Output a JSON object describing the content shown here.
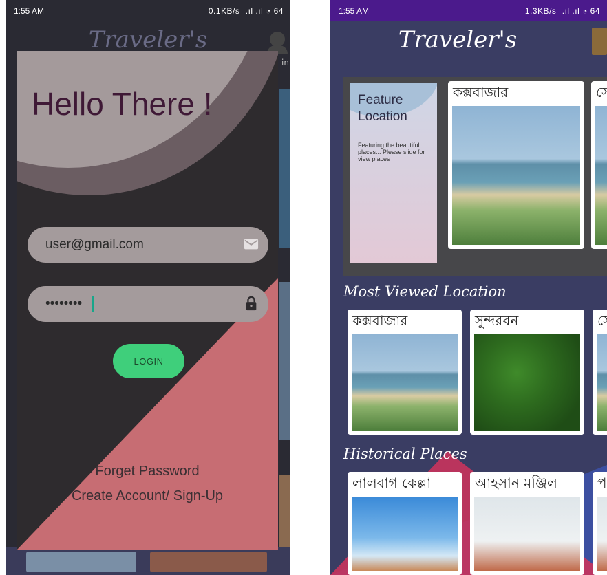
{
  "left_screen": {
    "status": {
      "time": "1:55 AM",
      "right": "0.1KB/s  .ıl .ıl ◔ 64"
    },
    "background_app": {
      "title": "Traveler's",
      "side_text": "in"
    },
    "login_dialog": {
      "heading": "Hello There !",
      "email_value": "user@gmail.com",
      "password_value": "••••••••",
      "login_label": "LOGIN",
      "forget_password": "Forget Password",
      "create_account": "Create Account/ Sign-Up"
    },
    "colors": {
      "dialog_bg": "#2e2b2e",
      "accent_red": "#c76d73",
      "login_green": "#3fcf7b",
      "heading": "#3f1936"
    }
  },
  "right_screen": {
    "status": {
      "time": "1:55 AM",
      "right": "1.3KB/s  .ıl .ıl ◔ 64"
    },
    "app_title": "Traveler's",
    "feature": {
      "title": "Feature Location",
      "description": "Featuring the beautiful places... Please slide for view places",
      "cards": [
        {
          "label": "কক্সবাজার"
        },
        {
          "label": "সে"
        }
      ]
    },
    "most_viewed": {
      "title": "Most Viewed Location",
      "cards": [
        {
          "label": "কক্সবাজার"
        },
        {
          "label": "সুন্দরবন"
        },
        {
          "label": "সে"
        }
      ]
    },
    "historical": {
      "title": "Historical Places",
      "cards": [
        {
          "label": "লালবাগ কেল্লা"
        },
        {
          "label": "আহসান মঞ্জিল"
        },
        {
          "label": "পা"
        }
      ]
    }
  }
}
